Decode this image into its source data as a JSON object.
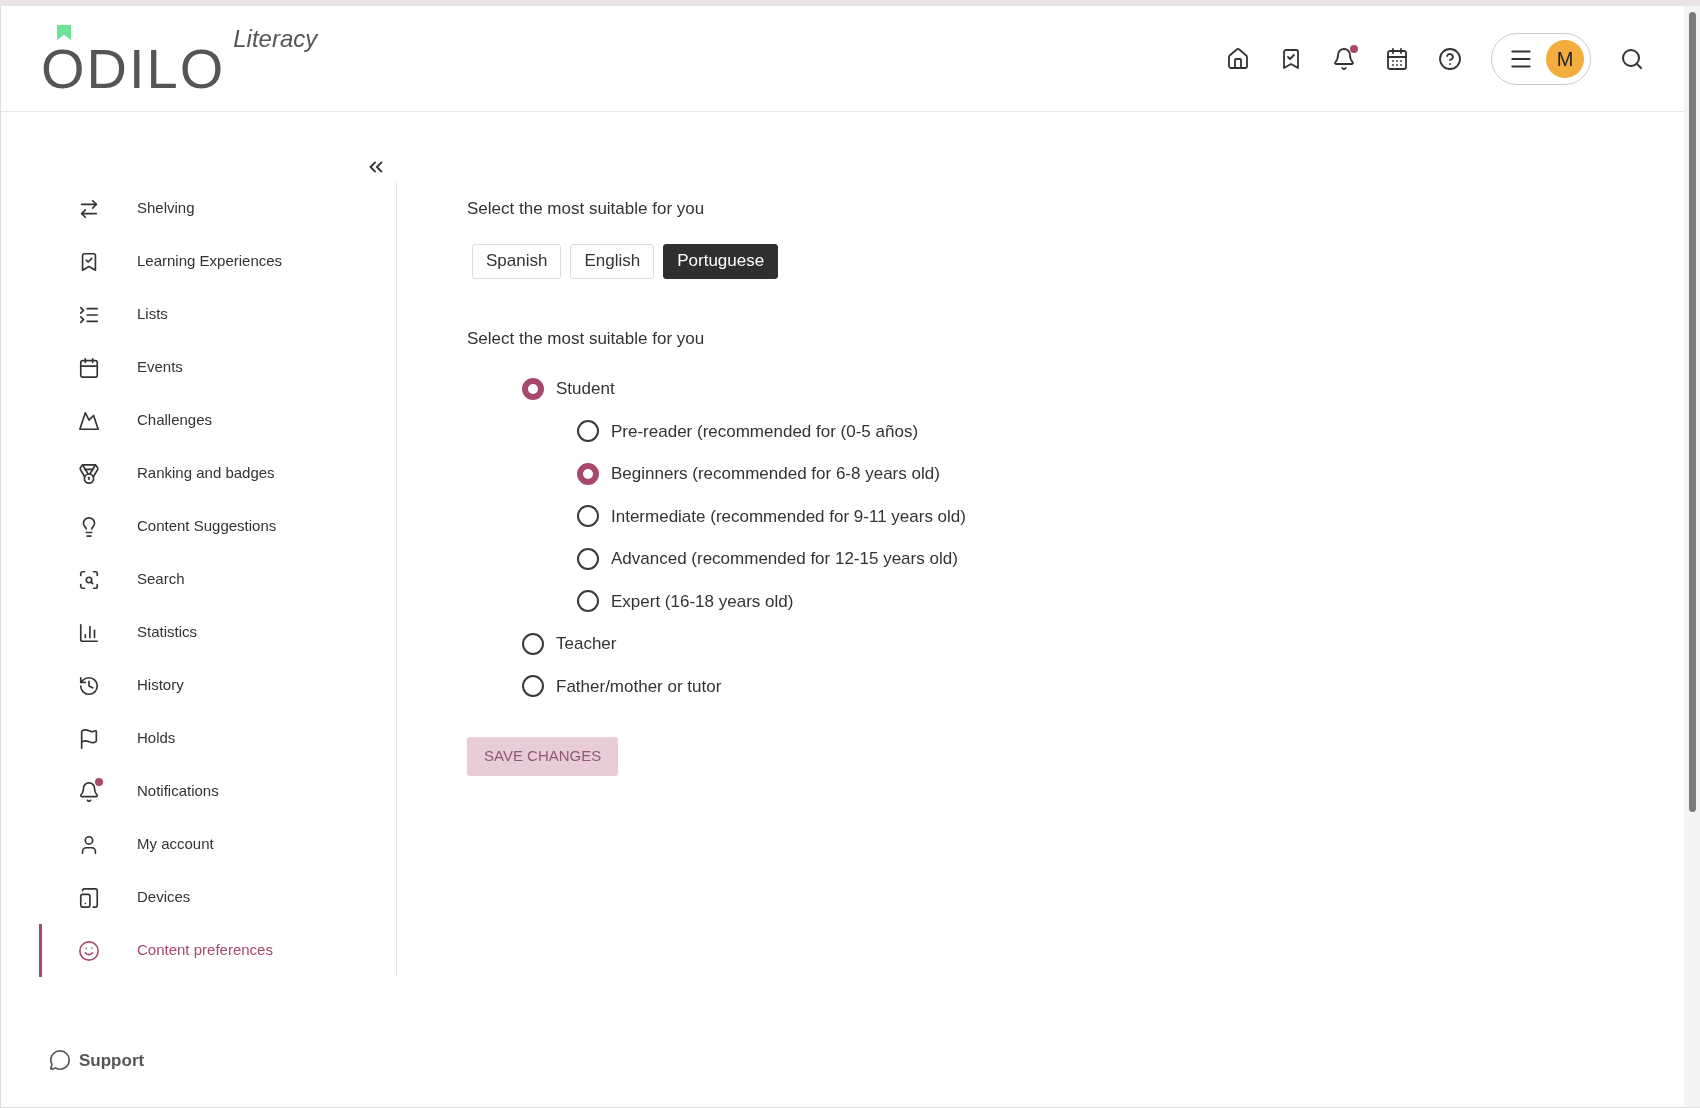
{
  "header": {
    "logo": {
      "name": "ODILO",
      "product": "Literacy"
    },
    "icons": [
      {
        "kind": "home",
        "unread": false
      },
      {
        "kind": "bookmark",
        "unread": false
      },
      {
        "kind": "bell",
        "unread": true
      },
      {
        "kind": "calendar",
        "unread": false
      },
      {
        "kind": "help",
        "unread": false
      }
    ],
    "avatar": "M"
  },
  "sidebar": {
    "items": [
      {
        "label": "Shelving",
        "selected": false,
        "unread": false
      },
      {
        "label": "Learning Experiences",
        "selected": false,
        "unread": false
      },
      {
        "label": "Lists",
        "selected": false,
        "unread": false
      },
      {
        "label": "Events",
        "selected": false,
        "unread": false
      },
      {
        "label": "Challenges",
        "selected": false,
        "unread": false
      },
      {
        "label": "Ranking and badges",
        "selected": false,
        "unread": false
      },
      {
        "label": "Content Suggestions",
        "selected": false,
        "unread": false
      },
      {
        "label": "Search",
        "selected": false,
        "unread": false
      },
      {
        "label": "Statistics",
        "selected": false,
        "unread": false
      },
      {
        "label": "History",
        "selected": false,
        "unread": false
      },
      {
        "label": "Holds",
        "selected": false,
        "unread": false
      },
      {
        "label": "Notifications",
        "selected": false,
        "unread": true
      },
      {
        "label": "My account",
        "selected": false,
        "unread": false
      },
      {
        "label": "Devices",
        "selected": false,
        "unread": false
      },
      {
        "label": "Content preferences",
        "selected": true,
        "unread": false
      }
    ],
    "support": "Support"
  },
  "content": {
    "language_prompt": "Select the most suitable for you",
    "languages": [
      {
        "label": "Spanish",
        "selected": false
      },
      {
        "label": "English",
        "selected": false
      },
      {
        "label": "Portuguese",
        "selected": true
      }
    ],
    "profile_prompt": "Select the most suitable for you",
    "profiles": [
      {
        "label": "Student",
        "selected": true,
        "children": [
          {
            "label": "Pre-reader (recommended for (0-5 años)",
            "selected": false
          },
          {
            "label": "Beginners (recommended for 6-8 years old)",
            "selected": true
          },
          {
            "label": "Intermediate (recommended for 9-11 years old)",
            "selected": false
          },
          {
            "label": "Advanced (recommended for 12-15 years old)",
            "selected": false
          },
          {
            "label": "Expert (16-18 years old)",
            "selected": false
          }
        ]
      },
      {
        "label": "Teacher",
        "selected": false
      },
      {
        "label": "Father/mother or tutor",
        "selected": false
      }
    ],
    "save_button": {
      "label": "SAVE CHANGES",
      "disabled": true
    }
  }
}
